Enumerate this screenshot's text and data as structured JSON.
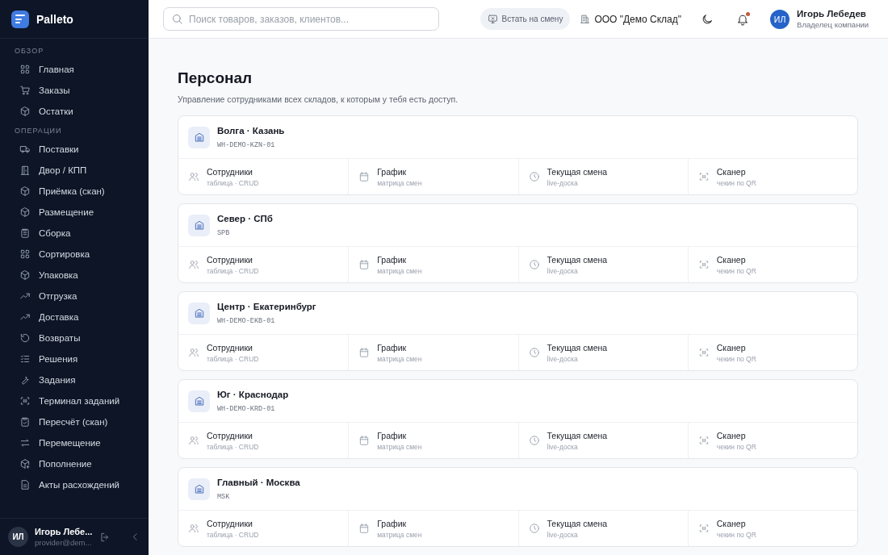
{
  "brand": {
    "name": "Palleto"
  },
  "sidebar": {
    "sections": [
      {
        "title": "ОБЗОР",
        "items": [
          {
            "label": "Главная"
          },
          {
            "label": "Заказы"
          },
          {
            "label": "Остатки"
          }
        ]
      },
      {
        "title": "ОПЕРАЦИИ",
        "items": [
          {
            "label": "Поставки"
          },
          {
            "label": "Двор / КПП"
          },
          {
            "label": "Приёмка (скан)"
          },
          {
            "label": "Размещение"
          },
          {
            "label": "Сборка"
          },
          {
            "label": "Сортировка"
          },
          {
            "label": "Упаковка"
          },
          {
            "label": "Отгрузка"
          },
          {
            "label": "Доставка"
          },
          {
            "label": "Возвраты"
          },
          {
            "label": "Решения"
          },
          {
            "label": "Задания"
          },
          {
            "label": "Терминал заданий"
          },
          {
            "label": "Пересчёт (скан)"
          },
          {
            "label": "Перемещение"
          },
          {
            "label": "Пополнение"
          },
          {
            "label": "Акты расхождений"
          }
        ]
      }
    ],
    "user": {
      "initials": "ИЛ",
      "name": "Игорь Лебе...",
      "email": "provider@dem..."
    }
  },
  "topbar": {
    "search": {
      "placeholder": "Поиск товаров, заказов, клиентов..."
    },
    "shift_button": "Встать на смену",
    "company": "ООО \"Демо Склад\"",
    "notifications_unread": true,
    "user": {
      "initials": "ИЛ",
      "name": "Игорь Лебедев",
      "role": "Владелец компании"
    }
  },
  "page": {
    "title": "Персонал",
    "subtitle": "Управление сотрудниками всех складов, к которым у тебя есть доступ."
  },
  "warehouses": [
    {
      "name": "Волга · Казань",
      "code": "WH-DEMO-KZN-01",
      "actions": [
        {
          "title": "Сотрудники",
          "hint": "таблица · CRUD"
        },
        {
          "title": "График",
          "hint": "матрица смен"
        },
        {
          "title": "Текущая смена",
          "hint": "live-доска"
        },
        {
          "title": "Сканер",
          "hint": "чекин по QR"
        }
      ]
    },
    {
      "name": "Север · СПб",
      "code": "SPB",
      "actions": [
        {
          "title": "Сотрудники",
          "hint": "таблица · CRUD"
        },
        {
          "title": "График",
          "hint": "матрица смен"
        },
        {
          "title": "Текущая смена",
          "hint": "live-доска"
        },
        {
          "title": "Сканер",
          "hint": "чекин по QR"
        }
      ]
    },
    {
      "name": "Центр · Екатеринбург",
      "code": "WH-DEMO-EKB-01",
      "actions": [
        {
          "title": "Сотрудники",
          "hint": "таблица · CRUD"
        },
        {
          "title": "График",
          "hint": "матрица смен"
        },
        {
          "title": "Текущая смена",
          "hint": "live-доска"
        },
        {
          "title": "Сканер",
          "hint": "чекин по QR"
        }
      ]
    },
    {
      "name": "Юг · Краснодар",
      "code": "WH-DEMO-KRD-01",
      "actions": [
        {
          "title": "Сотрудники",
          "hint": "таблица · CRUD"
        },
        {
          "title": "График",
          "hint": "матрица смен"
        },
        {
          "title": "Текущая смена",
          "hint": "live-доска"
        },
        {
          "title": "Сканер",
          "hint": "чекин по QR"
        }
      ]
    },
    {
      "name": "Главный · Москва",
      "code": "MSK",
      "actions": [
        {
          "title": "Сотрудники",
          "hint": "таблица · CRUD"
        },
        {
          "title": "График",
          "hint": "матрица смен"
        },
        {
          "title": "Текущая смена",
          "hint": "live-доска"
        },
        {
          "title": "Сканер",
          "hint": "чекин по QR"
        }
      ]
    }
  ]
}
